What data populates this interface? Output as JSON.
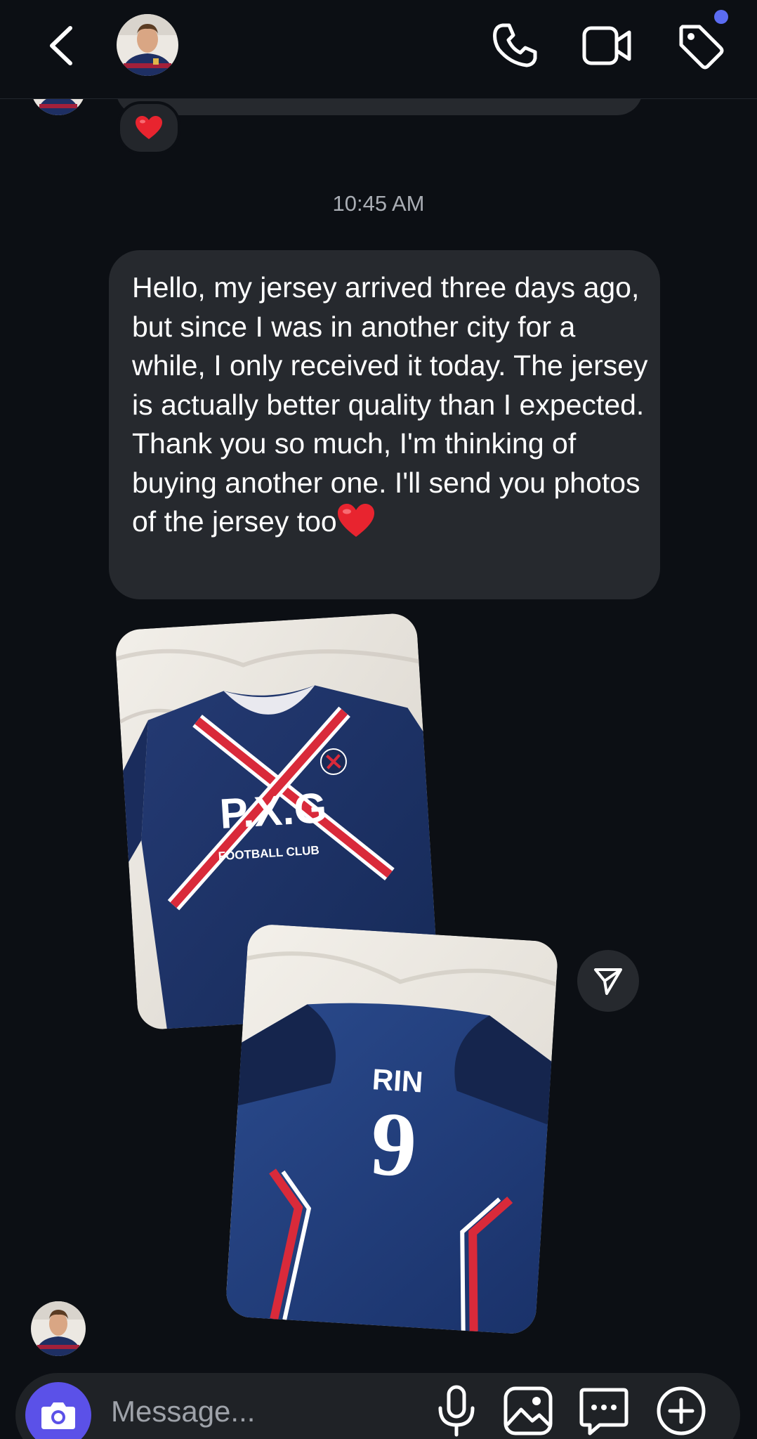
{
  "header": {
    "back_icon": "chevron-left-icon",
    "contact_avatar": "avatar",
    "actions": [
      {
        "name": "call",
        "icon": "phone-icon"
      },
      {
        "name": "video",
        "icon": "video-camera-icon"
      },
      {
        "name": "tag",
        "icon": "tag-icon"
      }
    ],
    "notification_dot_color": "#5b6cf2"
  },
  "conversation": {
    "previous_reaction": "❤️",
    "timestamp": "10:45 AM",
    "message": {
      "text": "Hello, my jersey arrived three days ago, but since I was in another city for a while, I only received it today. The jersey is actually better quality than I expected. Thank you so much, I'm thinking of buying another one. I'll send you photos of the jersey too",
      "trailing_emoji": "❤️",
      "bubble_color": "#26292e"
    },
    "photos": [
      {
        "label": "jersey-front-photo",
        "jersey_crest_text": "P.X.G",
        "jersey_subtext": "FOOTBALL CLUB"
      },
      {
        "label": "jersey-back-photo",
        "jersey_name": "RIN",
        "jersey_number": "9"
      }
    ],
    "share_icon": "send-icon"
  },
  "composer": {
    "placeholder": "Message...",
    "camera_color": "#5b51e8",
    "icons": [
      "camera-icon",
      "microphone-icon",
      "gallery-icon",
      "sticker-icon",
      "plus-circle-icon"
    ]
  },
  "colors": {
    "background": "#0c0f14",
    "bubble": "#26292e",
    "accent": "#5b51e8",
    "jersey_navy": "#1d3264",
    "stripe_red": "#d92a3a"
  }
}
